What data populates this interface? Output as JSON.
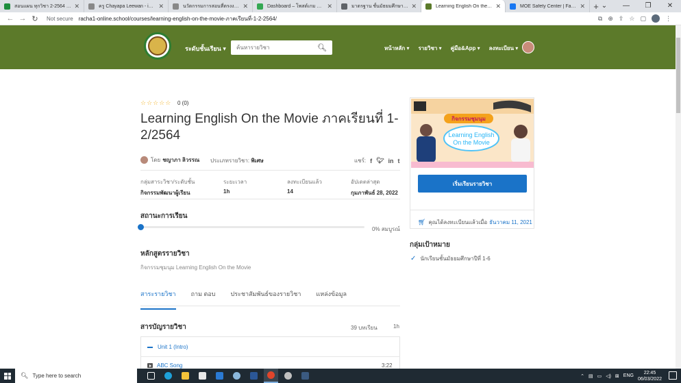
{
  "browser": {
    "tabs": [
      {
        "title": "สอนแผน ทุกวิชา 2-2564 ชญาภา ลิ…",
        "color": "#1e8e3e",
        "active": false
      },
      {
        "title": "ครู Chayapa Leewan - insKru เพื่อ…",
        "color": "#888888",
        "active": false
      },
      {
        "title": "นวัตกรรมการสอนที่ตรงงานสอนสืบค้น…",
        "color": "#888888",
        "active": false
      },
      {
        "title": "Dashboard – โพสต์เกม กลุ่มนิเทศ…",
        "color": "#34a853",
        "active": false
      },
      {
        "title": "มาตรฐาน ชั้นมัธยมศึกษาปีที่ 2/9 ปี…",
        "color": "#5f6368",
        "active": false
      },
      {
        "title": "Learning English On the Movie…",
        "color": "#5b7a2a",
        "active": true
      },
      {
        "title": "MOE Safety Center | Facebook",
        "color": "#1877f2",
        "active": false
      }
    ],
    "not_secure": "Not secure",
    "url": "racha1-online.school/courses/learning-english-on-the-movie-ภาคเรียนที่-1-2-2564/"
  },
  "header": {
    "levels_label": "ระดับชั้นเรียน ▾",
    "search_placeholder": "ค้นหารายวิชา",
    "nav": [
      "หน้าหลัก ▾",
      "รายวิชา ▾",
      "คู่มือ&App ▾",
      "ลงทะเบียน ▾"
    ]
  },
  "course": {
    "stars": "☆☆☆☆☆",
    "rating": "0 (0)",
    "title": "Learning English On the Movie ภาคเรียนที่ 1-2/2564",
    "by_label": "โดย",
    "instructor": "ชญาภา ลิวรรณ",
    "category_label": "ประเภทรายวิชา:",
    "category_value": "พิเศษ",
    "share_label": "แชร์:",
    "share_icons": [
      "f",
      "t",
      "in",
      "t"
    ],
    "meta": [
      {
        "label": "กลุ่มสาระวิชา/ระดับชั้น",
        "value": "กิจกรรมพัฒนาผู้เรียน"
      },
      {
        "label": "ระยะเวลา",
        "value": "1h"
      },
      {
        "label": "ลงทะเบียนแล้ว",
        "value": "14"
      },
      {
        "label": "อัปเดตล่าสุด",
        "value": "กุมภาพันธ์ 28, 2022"
      }
    ],
    "status_title": "สถานะการเรียน",
    "progress_percent": 0,
    "progress_text": "0% สมบูรณ์",
    "curriculum_title": "หลักสูตรรายวิชา",
    "curriculum_desc": "กิจกรรมชุมนุม Learning English On the Movie",
    "tabs": [
      "สาระรายวิชา",
      "ถาม ตอบ",
      "ประชาสัมพันธ์ของรายวิชา",
      "แหล่งข้อมูล"
    ],
    "toc_title": "สารบัญรายวิชา",
    "toc_count": "39 บทเรียน",
    "toc_duration": "1h",
    "unit_title": "Unit 1 (Intro)",
    "lesson_title": "ABC Song",
    "lesson_duration": "3:22"
  },
  "sidebar": {
    "thumb_activity": "กิจกรรมชุมนุม",
    "thumb_line1": "Learning English",
    "thumb_line2": "On the Movie",
    "start_button": "เริ่มเรียนรายวิชา",
    "enrolled_text": "คุณได้ลงทะเบียนแล้วเมื่อ",
    "enrolled_date": "ธันวาคม 11, 2021",
    "target_title": "กลุ่มเป้าหมาย",
    "target_item": "นักเรียนชั้นมัธยมศึกษาปีที่ 1-6"
  },
  "taskbar": {
    "search_placeholder": "Type here to search",
    "lang": "ENG",
    "time": "22:45",
    "date": "06/03/2022"
  },
  "colors": {
    "header_green": "#5c7a2a",
    "accent_blue": "#1a73c8",
    "star": "#f2b01e"
  }
}
